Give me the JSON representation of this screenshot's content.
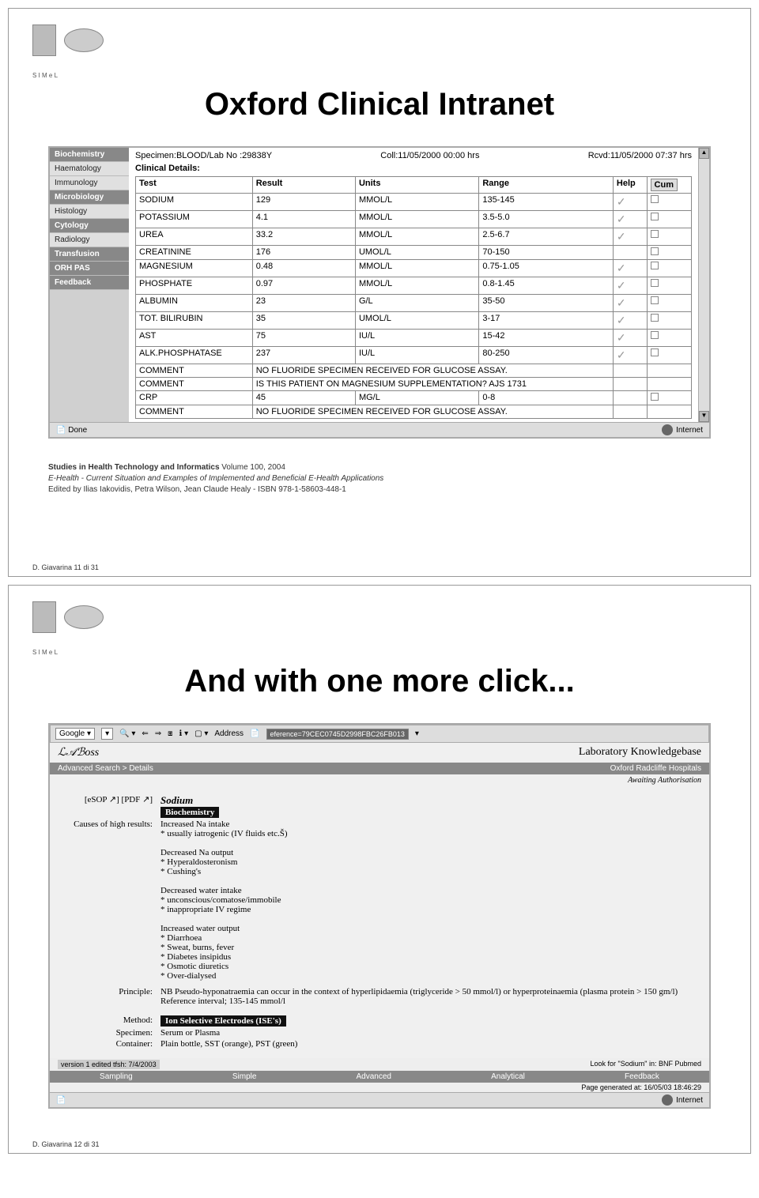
{
  "slide1": {
    "title": "Oxford Clinical Intranet",
    "specimen": "Specimen:BLOOD/Lab No :29838Y",
    "coll": "Coll:11/05/2000 00:00 hrs",
    "rcvd": "Rcvd:11/05/2000 07:37 hrs",
    "clinical_details": "Clinical Details:",
    "sidebar": [
      "Biochemistry",
      "Haematology",
      "Immunology",
      "Microbiology",
      "Histology",
      "Cytology",
      "Radiology",
      "Transfusion",
      "ORH PAS",
      "Feedback"
    ],
    "headers": {
      "test": "Test",
      "result": "Result",
      "units": "Units",
      "range": "Range",
      "help": "Help",
      "cum": "Cum"
    },
    "rows": [
      {
        "test": "SODIUM",
        "result": "129",
        "units": "MMOL/L",
        "range": "135-145",
        "help": true,
        "cum": true
      },
      {
        "test": "POTASSIUM",
        "result": "4.1",
        "units": "MMOL/L",
        "range": "3.5-5.0",
        "help": true,
        "cum": true
      },
      {
        "test": "UREA",
        "result": "33.2",
        "units": "MMOL/L",
        "range": "2.5-6.7",
        "help": true,
        "cum": true
      },
      {
        "test": "CREATININE",
        "result": "176",
        "units": "UMOL/L",
        "range": "70-150",
        "help": false,
        "cum": true
      },
      {
        "test": "MAGNESIUM",
        "result": "0.48",
        "units": "MMOL/L",
        "range": "0.75-1.05",
        "help": true,
        "cum": true
      },
      {
        "test": "PHOSPHATE",
        "result": "0.97",
        "units": "MMOL/L",
        "range": "0.8-1.45",
        "help": true,
        "cum": true
      },
      {
        "test": "ALBUMIN",
        "result": "23",
        "units": "G/L",
        "range": "35-50",
        "help": true,
        "cum": true
      },
      {
        "test": "TOT. BILIRUBIN",
        "result": "35",
        "units": "UMOL/L",
        "range": "3-17",
        "help": true,
        "cum": true
      },
      {
        "test": "AST",
        "result": "75",
        "units": "IU/L",
        "range": "15-42",
        "help": true,
        "cum": true
      },
      {
        "test": "ALK.PHOSPHATASE",
        "result": "237",
        "units": "IU/L",
        "range": "80-250",
        "help": true,
        "cum": true
      },
      {
        "test": "COMMENT",
        "result": "NO FLUORIDE SPECIMEN RECEIVED FOR GLUCOSE ASSAY.",
        "units": "",
        "range": "",
        "help": false,
        "cum": false,
        "span": true
      },
      {
        "test": "COMMENT",
        "result": "IS THIS PATIENT ON MAGNESIUM SUPPLEMENTATION? AJS 1731",
        "units": "",
        "range": "",
        "help": false,
        "cum": false,
        "span": true
      },
      {
        "test": "CRP",
        "result": "45",
        "units": "MG/L",
        "range": "0-8",
        "help": false,
        "cum": true
      },
      {
        "test": "COMMENT",
        "result": "NO FLUORIDE SPECIMEN RECEIVED FOR GLUCOSE ASSAY.",
        "units": "",
        "range": "",
        "help": false,
        "cum": false,
        "span": true
      }
    ],
    "status_done": "Done",
    "status_net": "Internet",
    "citation": {
      "l1": "Studies in Health Technology and Informatics Volume 100, 2004",
      "l2": "E-Health - Current Situation and Examples of Implemented and Beneficial E-Health Applications",
      "l3": "Edited by Ilias Iakovidis, Petra Wilson, Jean Claude Healy - ISBN 978-1-58603-448-1"
    },
    "footer": "D. Giavarina   11 di 31"
  },
  "slide2": {
    "title": "And with one more click...",
    "toolbar": {
      "google": "Google",
      "address_label": "Address",
      "address_val": "eference=79CEC0745D2998FBC26FB013"
    },
    "header_left": "LABoss",
    "header_right": "Laboratory Knowledgebase",
    "tabbar_left": "Advanced Search > Details",
    "tabbar_right": "Oxford Radcliffe Hospitals",
    "awaiting": "Awaiting Authorisation",
    "esop_pdf": "[eSOP ↗] [PDF ↗]",
    "test_name": "Sodium",
    "dept": "Biochemistry",
    "causes_label": "Causes of high results:",
    "causes_lines": [
      "Increased Na intake",
      "* usually iatrogenic (IV fluids etc.Š)",
      "",
      "Decreased Na output",
      "* Hyperaldosteronism",
      "* Cushing's",
      "",
      "Decreased water intake",
      "* unconscious/comatose/immobile",
      "* inappropriate IV regime",
      "",
      "Increased water output",
      "* Diarrhoea",
      "* Sweat, burns, fever",
      "* Diabetes insipidus",
      "* Osmotic diuretics",
      "* Over-dialysed"
    ],
    "principle_label": "Principle:",
    "principle": "NB Pseudo-hyponatraemia can occur in the context of hyperlipidaemia (triglyceride > 50 mmol/l) or hyperproteinaemia (plasma protein > 150 gm/l)\nReference interval; 135-145 mmol/l",
    "method_label": "Method:",
    "method": "Ion Selective Electrodes (ISE's)",
    "specimen_label": "Specimen:",
    "specimen": "Serum or Plasma",
    "container_label": "Container:",
    "container": "Plain bottle, SST (orange), PST (green)",
    "version": "version 1 edited tfsh: 7/4/2003",
    "lookfor": "Look for \"Sodium\" in: BNF Pubmed",
    "bottom_tabs": [
      "Sampling",
      "Simple",
      "Advanced",
      "Analytical",
      "Feedback"
    ],
    "page_gen": "Page generated at: 16/05/03 18:46:29",
    "status_net": "Internet",
    "footer": "D. Giavarina   12 di 31"
  }
}
